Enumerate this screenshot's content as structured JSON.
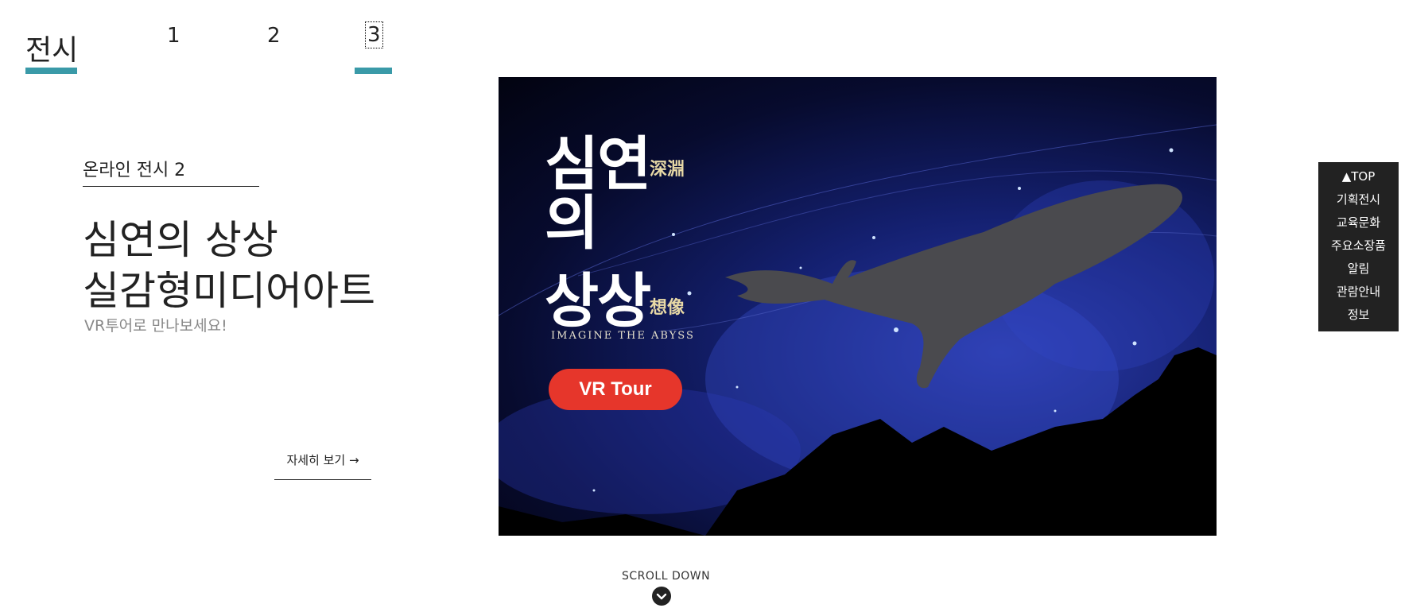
{
  "tabs": {
    "exhibit_label": "전시",
    "items": [
      "1",
      "2",
      "3"
    ],
    "active_index": 2
  },
  "info": {
    "online_label": "온라인 전시 2",
    "title_line1": "심연의 상상",
    "title_line2": "실감형미디어아트",
    "subtitle": "VR투어로 만나보세요!",
    "detail_link": "자세히 보기 →"
  },
  "banner": {
    "title_part1": "심연",
    "hanja_1": "深淵",
    "title_part2": "의",
    "title_part3": "상상",
    "hanja_2": "想像",
    "english": "IMAGINE THE ABYSS",
    "vr_button": "VR Tour"
  },
  "scroll": {
    "label": "SCROLL DOWN",
    "icon": "chevron-down-icon"
  },
  "quick_menu": {
    "top_label": "▲TOP",
    "items": [
      "기획전시",
      "교육문화",
      "주요소장품",
      "알림",
      "관람안내",
      "정보"
    ]
  },
  "colors": {
    "accent": "#3a9aa8",
    "vr_button": "#e6362b",
    "quick_menu_bg": "#222222"
  }
}
